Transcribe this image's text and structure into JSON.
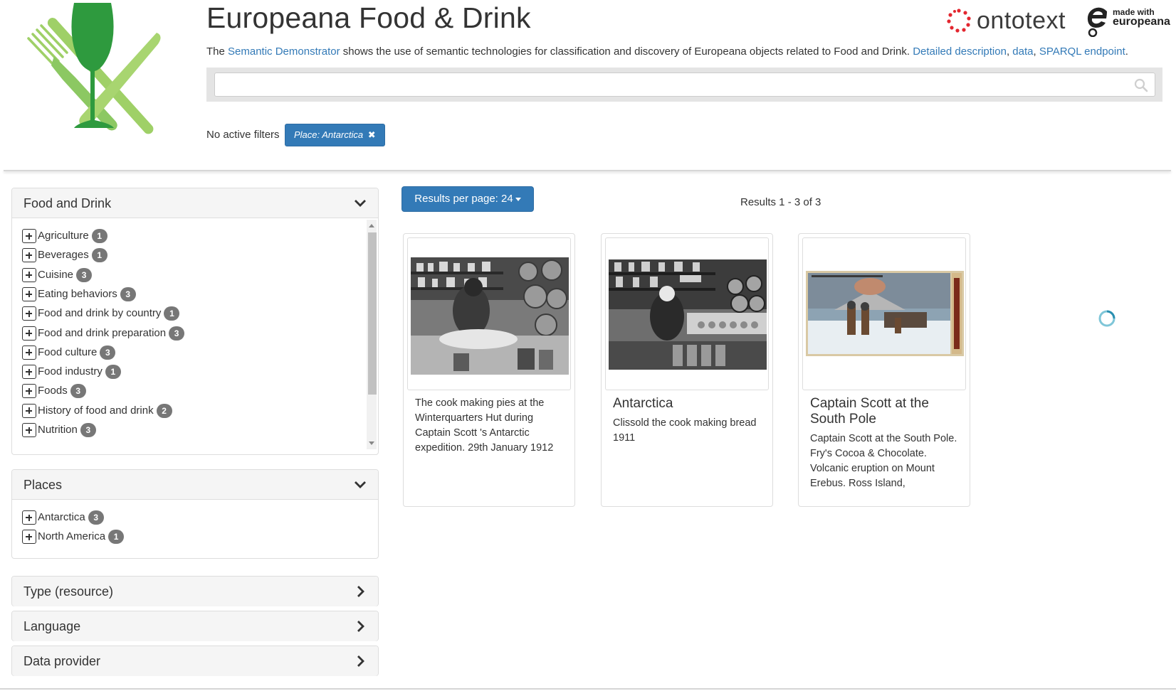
{
  "header": {
    "title": "Europeana Food & Drink",
    "intro_prefix": "The ",
    "intro_link": "Semantic Demonstrator",
    "intro_middle": " shows the use of semantic technologies for classification and discovery of Europeana objects related to Food and Drink. ",
    "link_detailed": "Detailed description",
    "sep1": ", ",
    "link_data": "data",
    "sep2": ", ",
    "link_sparql": "SPARQL endpoint",
    "end": ".",
    "ontotext_label": "ontotext",
    "made_with": "made with",
    "europeana_label": "europeana"
  },
  "search": {
    "value": "",
    "placeholder": "",
    "icon": "search-icon"
  },
  "filters": {
    "label": "No active filters",
    "chip_text": "Place: Antarctica",
    "chip_remove": "✖"
  },
  "sidebar": {
    "food_and_drink": {
      "title": "Food and Drink",
      "items": [
        {
          "label": "Agriculture",
          "count": "1"
        },
        {
          "label": "Beverages",
          "count": "1"
        },
        {
          "label": "Cuisine",
          "count": "3"
        },
        {
          "label": "Eating behaviors",
          "count": "3"
        },
        {
          "label": "Food and drink by country",
          "count": "1"
        },
        {
          "label": "Food and drink preparation",
          "count": "3"
        },
        {
          "label": "Food culture",
          "count": "3"
        },
        {
          "label": "Food industry",
          "count": "1"
        },
        {
          "label": "Foods",
          "count": "3"
        },
        {
          "label": "History of food and drink",
          "count": "2"
        },
        {
          "label": "Nutrition",
          "count": "3"
        }
      ]
    },
    "places": {
      "title": "Places",
      "items": [
        {
          "label": "Antarctica",
          "count": "3"
        },
        {
          "label": "North America",
          "count": "1"
        }
      ]
    },
    "type_resource": {
      "title": "Type (resource)"
    },
    "language": {
      "title": "Language"
    },
    "data_provider": {
      "title": "Data provider"
    }
  },
  "results": {
    "per_page_label": "Results per page: 24",
    "count_text": "Results 1 - 3 of 3",
    "cards": [
      {
        "title": "",
        "description": "The cook making pies at the Winterquarters Hut during Captain Scott 's Antarctic expedition. 29th January 1912"
      },
      {
        "title": "Antarctica",
        "description": "Clissold the cook making bread 1911"
      },
      {
        "title": "Captain Scott at the South Pole",
        "description": "Captain Scott at the South Pole. Fry's Cocoa & Chocolate. Volcanic eruption on Mount Erebus. Ross Island,"
      }
    ]
  },
  "colors": {
    "primary": "#337ab7",
    "badge": "#777777",
    "logo_green_dark": "#2e9a3e",
    "logo_green_light": "#a5d36a",
    "ontotext_red": "#e3262f"
  }
}
